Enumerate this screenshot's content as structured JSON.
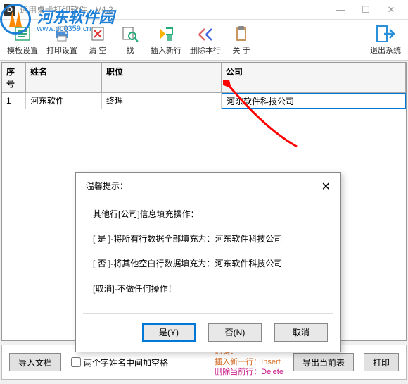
{
  "watermark": {
    "site_cn": "河东软件园",
    "site_url": "www.pc0359.cn"
  },
  "titlebar": {
    "app_icon_text": "D",
    "title": "通用桌卡打印软件。V4.2",
    "min": "—",
    "max": "☐",
    "close": "✕"
  },
  "toolbar": {
    "template": "模板设置",
    "print_setup": "打印设置",
    "clear": "清 空",
    "find": "找",
    "insert_row": "插入新行",
    "delete_row": "删除本行",
    "about": "关 于",
    "exit": "退出系统"
  },
  "columns": {
    "num": "序号",
    "name": "姓名",
    "pos": "职位",
    "comp": "公司"
  },
  "rows": [
    {
      "num": "1",
      "name": "河东软件",
      "pos": "终理",
      "comp": "河东软件科技公司"
    }
  ],
  "dialog": {
    "title": "温馨提示：",
    "line1": "其他行[公司]信息填充操作：",
    "line2": "[ 是 ]-将所有行数据全部填充为：河东软件科技公司",
    "line3": "[ 否 ]-将其他空白行数据填充为：河东软件科技公司",
    "line4": "[取消]-不做任何操作！",
    "yes": "是(Y)",
    "no": "否(N)",
    "cancel": "取消"
  },
  "bottom": {
    "import": "导入文档",
    "space_names": "两个字姓名中间加空格",
    "hotkeys_title": "热键：",
    "hotkey_insert": "插入新一行：Insert",
    "hotkey_delete": "删除当前行：Delete",
    "export": "导出当前表",
    "print": "打印"
  }
}
